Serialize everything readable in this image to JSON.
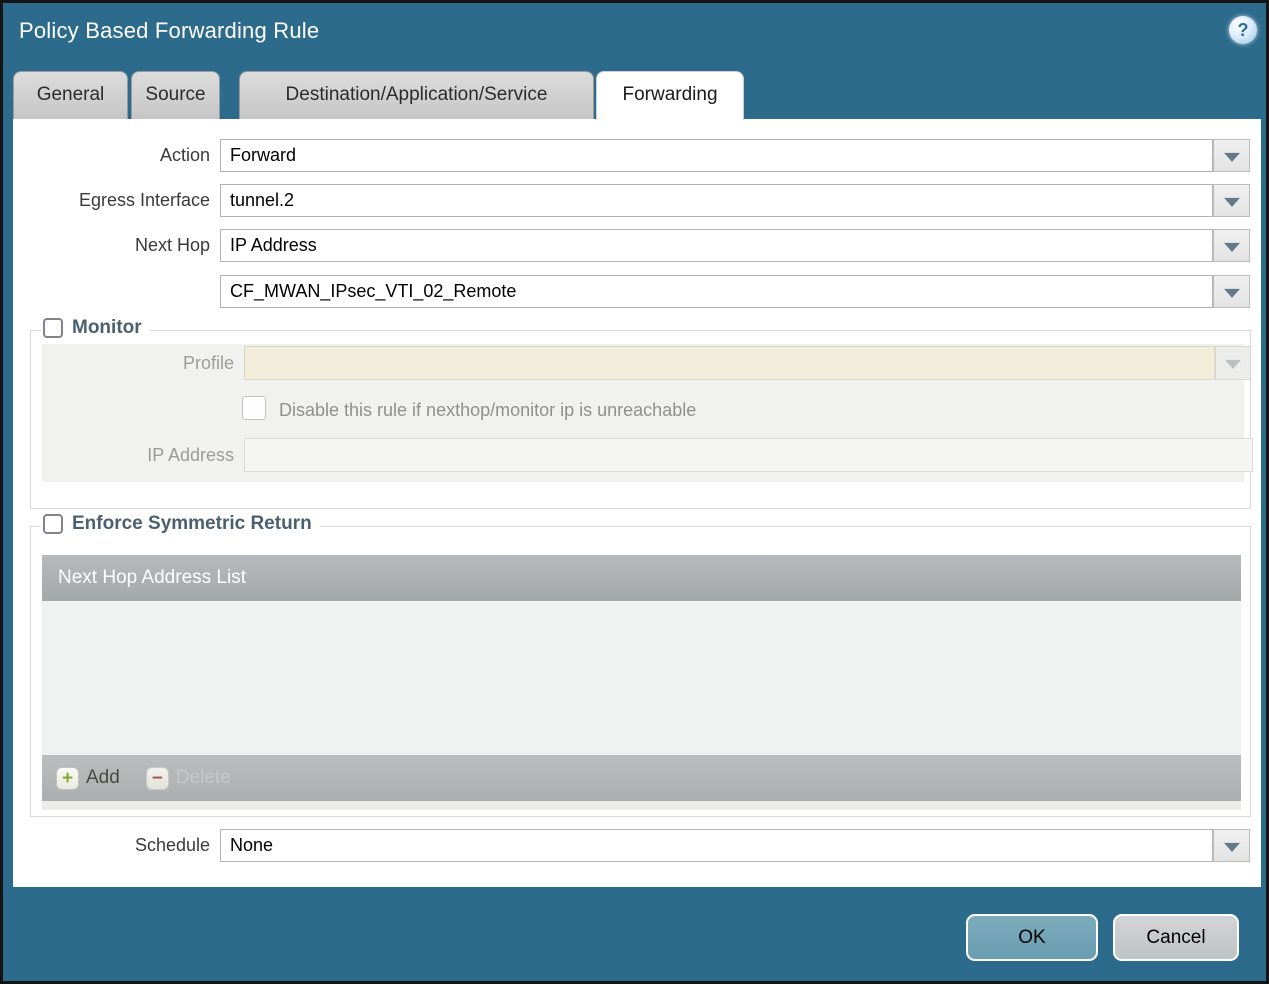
{
  "dialog": {
    "title": "Policy Based Forwarding Rule"
  },
  "icons": {
    "help": "?",
    "add": "+",
    "delete": "−",
    "dropdown": "chevron-down"
  },
  "tabs": [
    {
      "label": "General",
      "active": false
    },
    {
      "label": "Source",
      "active": false
    },
    {
      "label": "Destination/Application/Service",
      "active": false
    },
    {
      "label": "Forwarding",
      "active": true
    }
  ],
  "form": {
    "action": {
      "label": "Action",
      "value": "Forward"
    },
    "egress_interface": {
      "label": "Egress Interface",
      "value": "tunnel.2"
    },
    "next_hop": {
      "label": "Next Hop",
      "value": "IP Address"
    },
    "next_hop_address": {
      "value": "CF_MWAN_IPsec_VTI_02_Remote"
    },
    "schedule": {
      "label": "Schedule",
      "value": "None"
    }
  },
  "monitor": {
    "legend": "Monitor",
    "checked": false,
    "profile_label": "Profile",
    "profile_value": "",
    "disable_checkbox_label": "Disable this rule if nexthop/monitor ip is unreachable",
    "disable_checkbox_checked": false,
    "ip_address_label": "IP Address",
    "ip_address_value": ""
  },
  "symmetric_return": {
    "legend": "Enforce Symmetric Return",
    "checked": false,
    "table_header": "Next Hop Address List",
    "rows": [],
    "add_label": "Add",
    "delete_label": "Delete"
  },
  "footer": {
    "ok_label": "OK",
    "cancel_label": "Cancel"
  },
  "colors": {
    "header_background": "#2d6b8c",
    "panel_background": "#ffffff",
    "legend_text": "#4b5f6f",
    "disabled_input": "#f2edda",
    "table_header_background": "#aaaeae",
    "ok_button": "#6fa5b7",
    "cancel_button": "#c6c9cc"
  }
}
